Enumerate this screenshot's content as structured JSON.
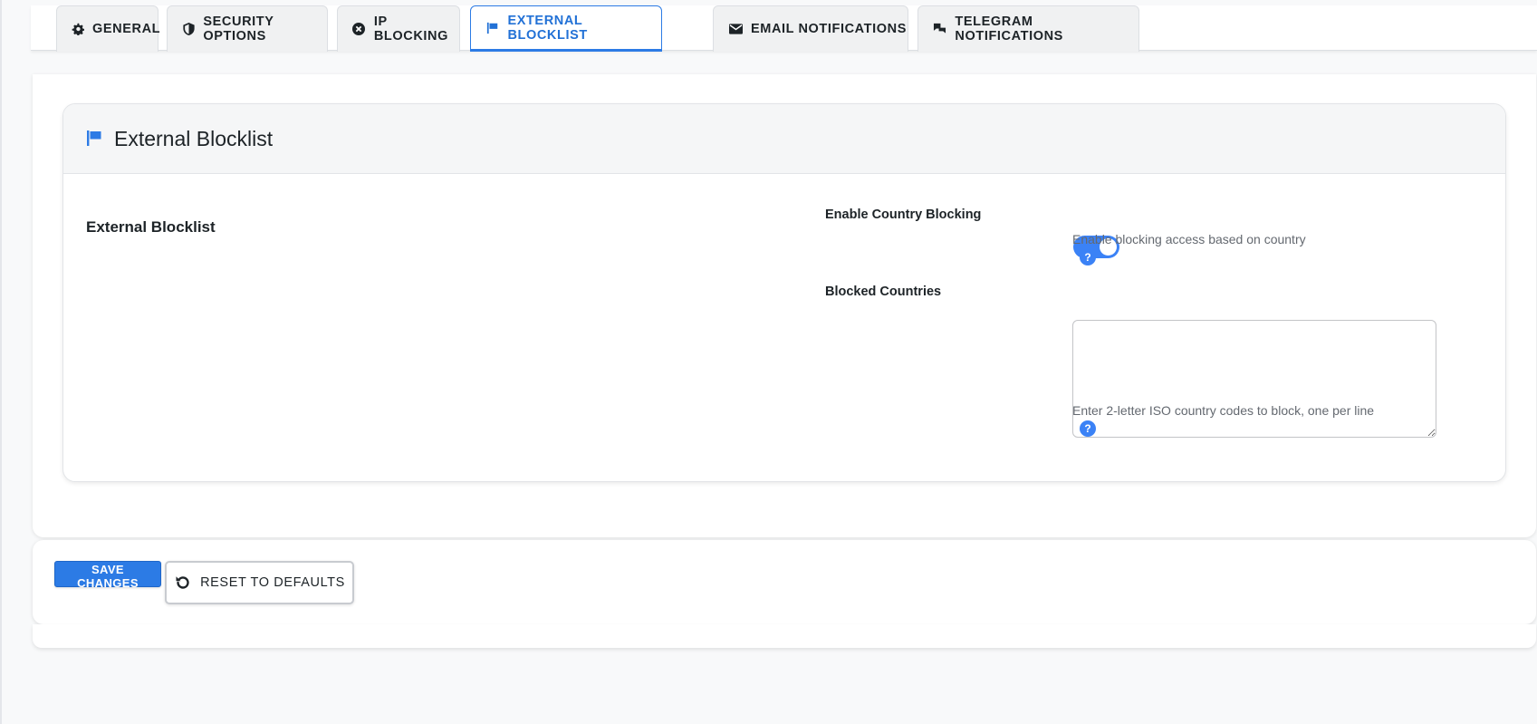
{
  "tabs": [
    {
      "label": "GENERAL",
      "icon": "gear-icon"
    },
    {
      "label": "SECURITY OPTIONS",
      "icon": "shield-icon"
    },
    {
      "label": "IP BLOCKING",
      "icon": "block-icon"
    },
    {
      "label": "EXTERNAL BLOCKLIST",
      "icon": "flag-icon",
      "active": true
    },
    {
      "label": "EMAIL NOTIFICATIONS",
      "icon": "envelope-icon"
    },
    {
      "label": "TELEGRAM NOTIFICATIONS",
      "icon": "chat-icon"
    }
  ],
  "card": {
    "title": "External Blocklist",
    "icon": "flag-icon",
    "section_label": "External Blocklist",
    "fields": {
      "country_blocking": {
        "label": "Enable Country Blocking",
        "enabled": true,
        "help": "Enable blocking access based on country"
      },
      "blocked_countries": {
        "label": "Blocked Countries",
        "value": "",
        "help": "Enter 2-letter ISO country codes to block, one per line"
      }
    }
  },
  "actions": {
    "save_label": "SAVE CHANGES",
    "reset_label": "RESET TO DEFAULTS"
  },
  "colors": {
    "accent": "#2c7be5",
    "toggle_on": "#3b82f6"
  }
}
